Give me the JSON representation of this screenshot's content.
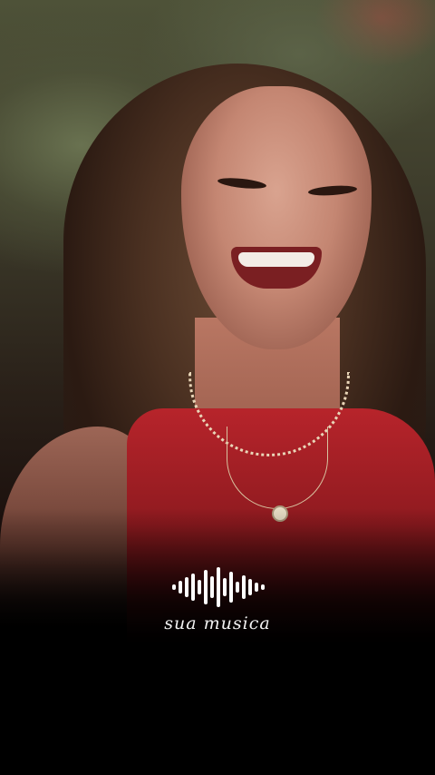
{
  "overlay": {
    "brand_label": "sua musica",
    "waveform_icon": "audio-waveform-icon"
  },
  "colors": {
    "background": "#000000",
    "overlay_text": "#ffffff",
    "top_red": "#b7242b"
  }
}
